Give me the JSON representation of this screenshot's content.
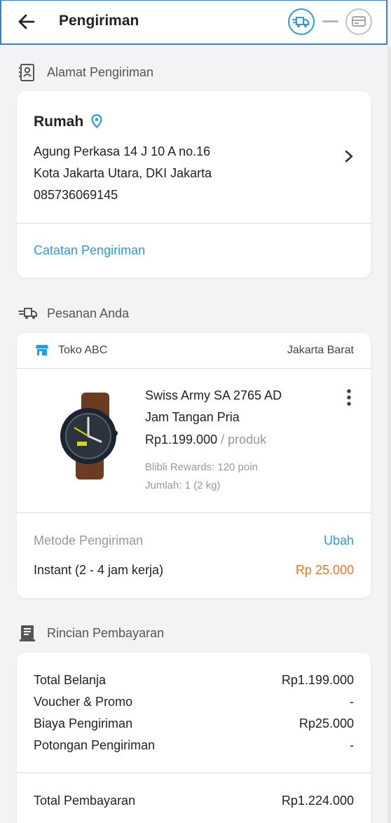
{
  "header": {
    "title": "Pengiriman"
  },
  "address_section": {
    "label": "Alamat Pengiriman",
    "name": "Rumah",
    "line1": "Agung Perkasa 14 J 10 A no.16",
    "line2": "Kota Jakarta Utara, DKI Jakarta",
    "phone": "085736069145",
    "note_link": "Catatan Pengiriman"
  },
  "order_section": {
    "label": "Pesanan Anda",
    "store_name": "Toko ABC",
    "store_location": "Jakarta Barat",
    "product": {
      "name_line1": "Swiss Army SA 2765 AD",
      "name_line2": "Jam Tangan Pria",
      "price": "Rp1.199.000",
      "price_unit": "/ produk",
      "rewards": "Blibli Rewards: 120 poin",
      "quantity": "Jumlah: 1 (2 kg)"
    },
    "shipping_method_label": "Metode Pengiriman",
    "change_link": "Ubah",
    "shipping_method": "Instant (2 - 4 jam kerja)",
    "shipping_cost": "Rp 25.000"
  },
  "payment_section": {
    "label": "Rincian Pembayaran",
    "rows": [
      {
        "label": "Total Belanja",
        "value": "Rp1.199.000"
      },
      {
        "label": "Voucher & Promo",
        "value": "-"
      },
      {
        "label": "Biaya Pengiriman",
        "value": "Rp25.000"
      },
      {
        "label": "Potongan Pengiriman",
        "value": "-"
      }
    ],
    "total_label": "Total Pembayaran",
    "total_value": "Rp1.224.000"
  },
  "colors": {
    "accent_blue": "#2d9be0",
    "orange": "#f0762a",
    "header_border": "#3b7fd6"
  }
}
